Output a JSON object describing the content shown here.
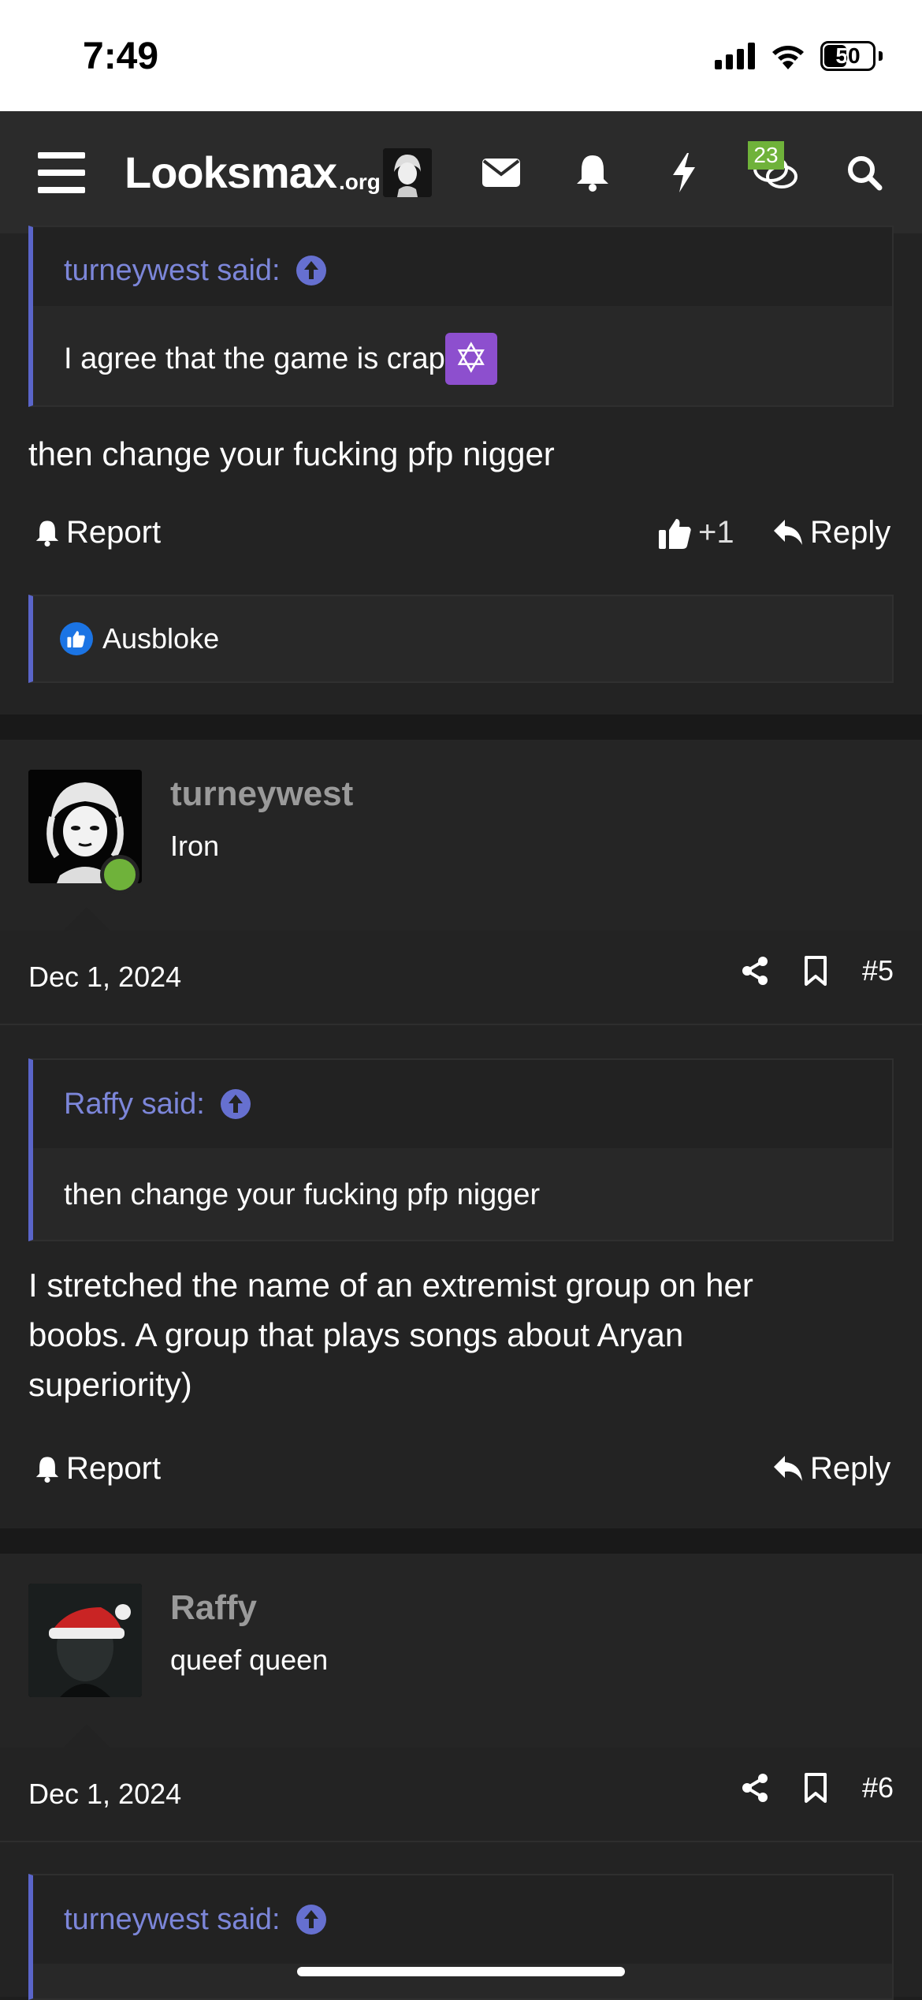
{
  "status_bar": {
    "time": "7:49",
    "battery": "50",
    "battery_level_percent": 50
  },
  "navbar": {
    "logo_main": "Looksmax",
    "logo_suffix": ".org",
    "chat_badge": "23",
    "icons": [
      "menu-icon",
      "envelope-icon",
      "bell-icon",
      "lightning-icon",
      "chat-icon",
      "search-icon"
    ]
  },
  "post4": {
    "quote_author": "turneywest said:",
    "quote_text": "I agree that the game is crap",
    "quote_emoji": "✡",
    "body": "then change your fucking pfp nigger",
    "report": "Report",
    "like_count": "+1",
    "reply": "Reply",
    "reactor": "Ausbloke"
  },
  "post5": {
    "username": "turneywest",
    "user_title": "Iron",
    "date": "Dec 1, 2024",
    "number": "#5",
    "quote_author": "Raffy said:",
    "quote_text": "then change your fucking pfp nigger",
    "body_lines": [
      "I stretched the name of an extremist group on her",
      "boobs. A group that plays songs about Aryan",
      "superiority)"
    ],
    "report": "Report",
    "reply": "Reply"
  },
  "post6": {
    "username": "Raffy",
    "user_title": "queef queen",
    "date": "Dec 1, 2024",
    "number": "#6",
    "quote_author": "turneywest said:"
  },
  "colors": {
    "accent": "#5a65c9",
    "quote_author": "#7c86d9",
    "online": "#6fb23a",
    "badge": "#6fb23a",
    "background": "#1e1e1e"
  }
}
